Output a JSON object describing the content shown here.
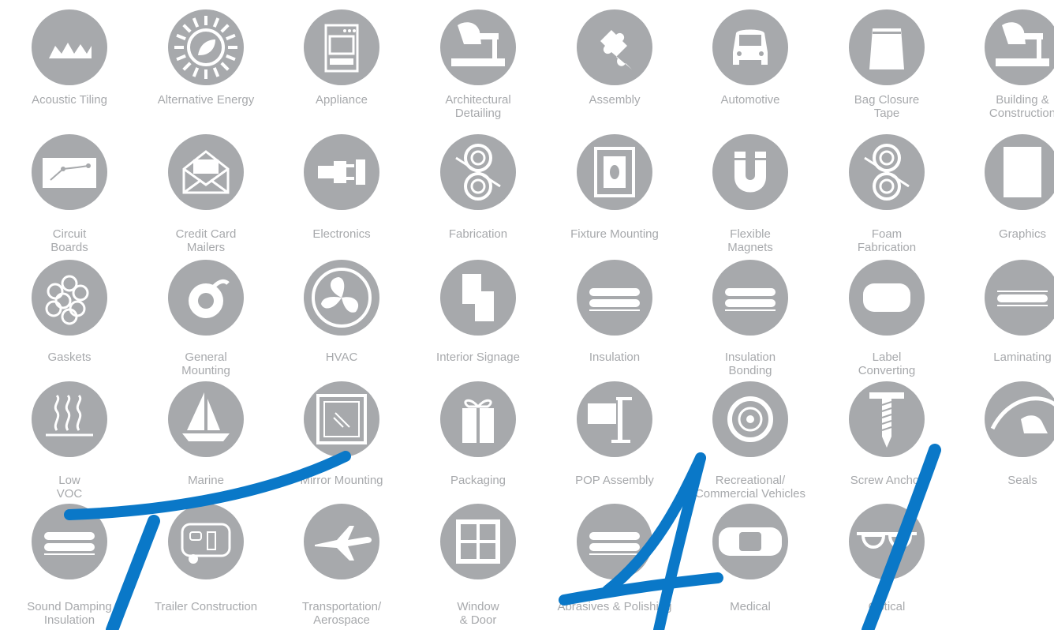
{
  "items": [
    {
      "label": "Acoustic Tiling",
      "icon": "acoustic-tiling-icon"
    },
    {
      "label": "Alternative Energy",
      "icon": "sun-leaf-icon"
    },
    {
      "label": "Appliance",
      "icon": "stove-icon"
    },
    {
      "label": "Architectural\nDetailing",
      "icon": "hand-hammer-icon"
    },
    {
      "label": "Assembly",
      "icon": "puzzle-piece-icon"
    },
    {
      "label": "Automotive",
      "icon": "car-icon"
    },
    {
      "label": "Bag Closure\nTape",
      "icon": "bag-icon"
    },
    {
      "label": "Building &\nConstruction",
      "icon": "hand-hammer-icon"
    },
    {
      "label": "Circuit\nBoards",
      "icon": "circuit-board-icon"
    },
    {
      "label": "Credit Card\nMailers",
      "icon": "envelope-icon"
    },
    {
      "label": "Electronics",
      "icon": "plug-icon"
    },
    {
      "label": "Fabrication",
      "icon": "rollers-icon"
    },
    {
      "label": "Fixture Mounting",
      "icon": "frame-icon"
    },
    {
      "label": "Flexible\nMagnets",
      "icon": "magnet-icon"
    },
    {
      "label": "Foam\nFabrication",
      "icon": "rollers-icon"
    },
    {
      "label": "Graphics",
      "icon": "sheet-icon"
    },
    {
      "label": "Gaskets",
      "icon": "rings-icon"
    },
    {
      "label": "General\nMounting",
      "icon": "tape-roll-icon"
    },
    {
      "label": "HVAC",
      "icon": "fan-icon"
    },
    {
      "label": "Interior Signage",
      "icon": "sign-icon"
    },
    {
      "label": "Insulation",
      "icon": "layers-icon"
    },
    {
      "label": "Insulation\nBonding",
      "icon": "layers-icon"
    },
    {
      "label": "Label\nConverting",
      "icon": "label-icon"
    },
    {
      "label": "Laminating",
      "icon": "laminate-icon"
    },
    {
      "label": "Low\nVOC",
      "icon": "vapor-icon"
    },
    {
      "label": "Marine",
      "icon": "sailboat-icon"
    },
    {
      "label": "Mirror Mounting",
      "icon": "mirror-icon"
    },
    {
      "label": "Packaging",
      "icon": "gift-icon"
    },
    {
      "label": "POP Assembly",
      "icon": "display-stand-icon"
    },
    {
      "label": "Recreational/\nCommercial Vehicles",
      "icon": "wheel-icon"
    },
    {
      "label": "Screw Anchor",
      "icon": "screw-icon"
    },
    {
      "label": "Seals",
      "icon": "seal-icon"
    },
    {
      "label": "Sound Damping\nInsulation",
      "icon": "layers-icon"
    },
    {
      "label": "Trailer Construction",
      "icon": "trailer-icon"
    },
    {
      "label": "Transportation/\nAerospace",
      "icon": "airplane-icon"
    },
    {
      "label": "Window\n& Door",
      "icon": "window-icon"
    },
    {
      "label": "Abrasives & Polishing",
      "icon": "layers-icon"
    },
    {
      "label": "Medical",
      "icon": "bandage-icon"
    },
    {
      "label": "Optical",
      "icon": "glasses-icon"
    }
  ],
  "colors": {
    "icon_bg": "#a7a9ac",
    "label": "#a7a9ac",
    "brush": "#0a78c8"
  }
}
